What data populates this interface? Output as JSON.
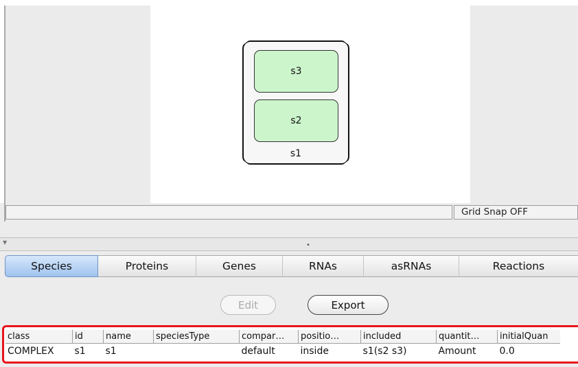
{
  "canvas": {
    "complex": {
      "label": "s1",
      "members": [
        "s3",
        "s2"
      ]
    }
  },
  "status_bar": {
    "left_text": "",
    "grid_snap": "Grid Snap OFF"
  },
  "tabs": [
    {
      "label": "Species",
      "active": true
    },
    {
      "label": "Proteins",
      "active": false
    },
    {
      "label": "Genes",
      "active": false
    },
    {
      "label": "RNAs",
      "active": false
    },
    {
      "label": "asRNAs",
      "active": false
    },
    {
      "label": "Reactions",
      "active": false
    }
  ],
  "actions": {
    "edit_label": "Edit",
    "edit_enabled": false,
    "export_label": "Export"
  },
  "table": {
    "columns": [
      "class",
      "id",
      "name",
      "speciesType",
      "compar…",
      "positio…",
      "included",
      "quantit…",
      "initialQuan"
    ],
    "rows": [
      [
        "COMPLEX",
        "s1",
        "s1",
        "",
        "default",
        "inside",
        "s1(s2 s3)",
        "Amount",
        "0.0"
      ]
    ]
  },
  "colors": {
    "species_fill": "#ccf5cc",
    "active_tab": "#9fc3ee",
    "highlight_outline": "#e8121b"
  }
}
